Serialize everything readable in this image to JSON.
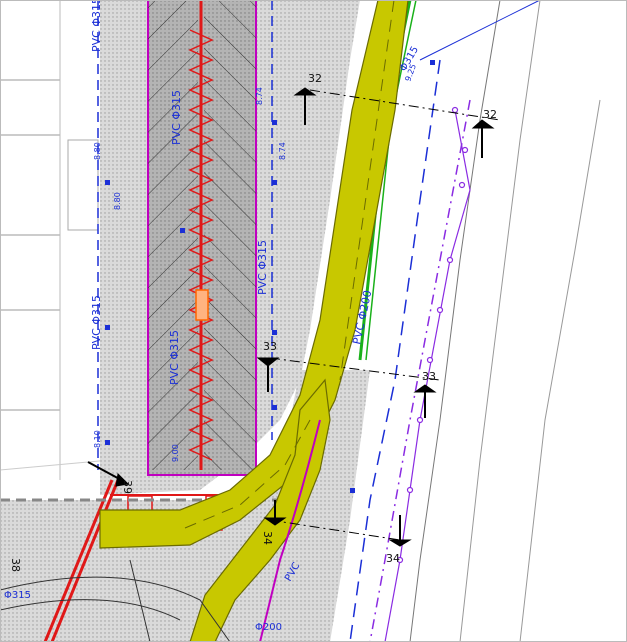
{
  "section_labels": {
    "s32_left": "32",
    "s32_right": "32",
    "s33_left": "33",
    "s33_right": "33",
    "s34_left": "34",
    "s34_right": "34",
    "s38": "38",
    "s39": "39"
  },
  "pipe_labels": {
    "pvc315_left": "PVC Φ315",
    "pvc315_center": "PVC Φ315",
    "pvc315_parking_top": "PVC Φ315",
    "pvc315_parking_bottom": "PVC Φ315",
    "pvc315_green": "Φ315",
    "pvc200_right": "PVC Φ200",
    "pvc200_bottom": "Φ200",
    "pvc315_bottom_left": "Φ315",
    "pvc_bottom_mid": "PVC"
  },
  "dimensions": {
    "d874": "8.74",
    "d874b": "8.74",
    "d880a": "8.80",
    "d880b": "8.80",
    "d925": "9.25",
    "d810": "8.10",
    "d900": "9.00"
  },
  "colors": {
    "road_fill": "#c8c800",
    "parking_fill": "#a9a9a9",
    "paving_fill": "#d4d4d4",
    "pipe_blue": "#1b2fd6",
    "fence_magenta": "#c000c0",
    "drain_red": "#e01818",
    "green_pipe": "#1ab11a",
    "purple_line": "#8a2be2"
  }
}
